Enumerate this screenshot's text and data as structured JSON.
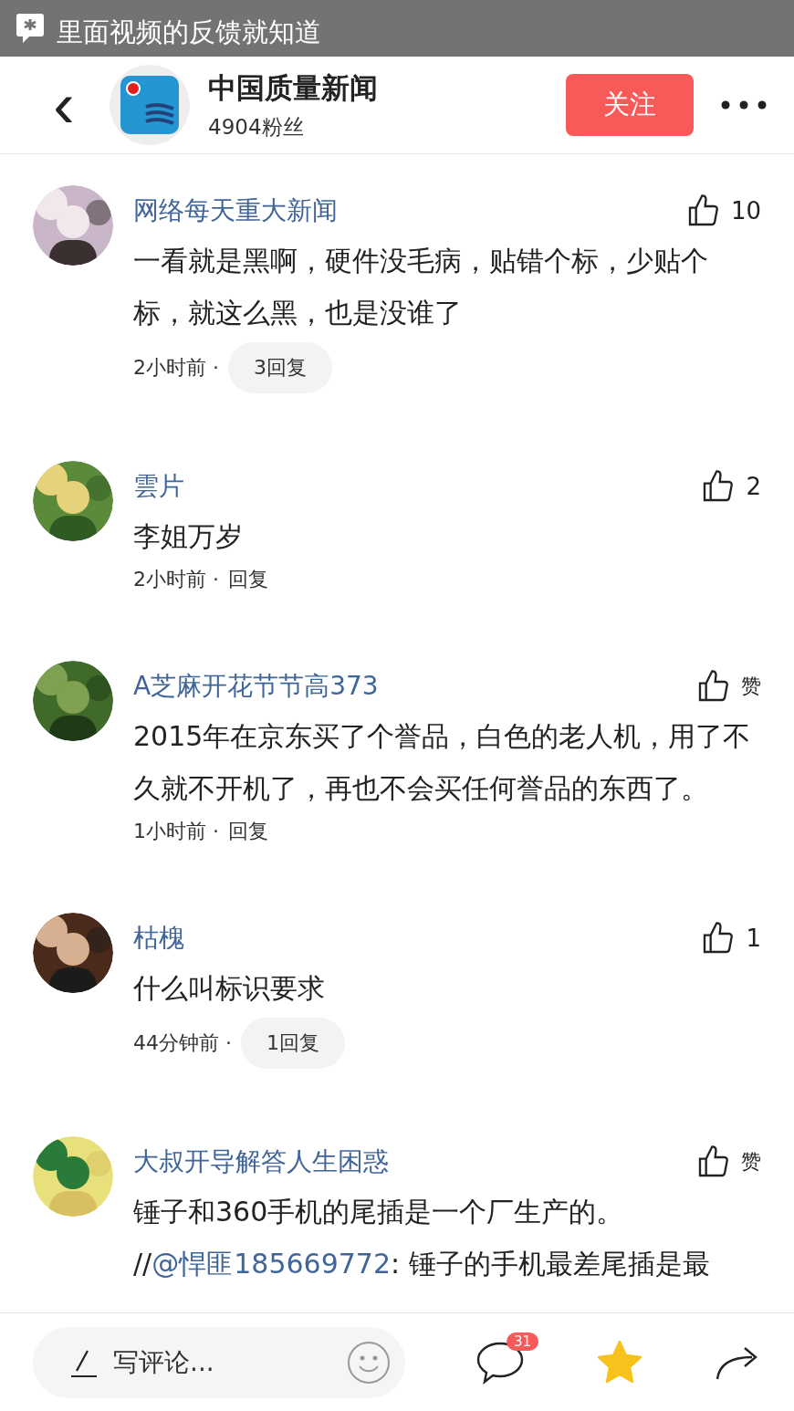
{
  "banner": {
    "text": "里面视频的反馈就知道"
  },
  "header": {
    "back": "‹",
    "account": "中国质量新闻",
    "fans": "4904粉丝",
    "follow": "关注"
  },
  "comments": [
    {
      "name": "网络每天重大新闻",
      "likes": "10",
      "body": [
        {
          "kind": "text",
          "text": "一看就是黑啊，硬件没毛病，贴错个标，少贴个标，就这么黑，也是没谁了"
        }
      ],
      "time": "2小时前 ·",
      "reply": {
        "kind": "pill",
        "label": "3回复"
      }
    },
    {
      "name": "雲片",
      "likes": "2",
      "body": [
        {
          "kind": "text",
          "text": "李姐万岁"
        }
      ],
      "time": "2小时前 ·",
      "reply": {
        "kind": "link",
        "label": "回复"
      }
    },
    {
      "name": "A芝麻开花节节高373",
      "likes": "赞",
      "body": [
        {
          "kind": "text",
          "text": "2015年在京东买了个誉品，白色的老人机，用了不久就不开机了，再也不会买任何誉品的东西了。"
        }
      ],
      "time": "1小时前 ·",
      "reply": {
        "kind": "link",
        "label": "回复"
      }
    },
    {
      "name": "枯槐",
      "likes": "1",
      "body": [
        {
          "kind": "text",
          "text": "什么叫标识要求"
        }
      ],
      "time": "44分钟前 ·",
      "reply": {
        "kind": "pill",
        "label": "1回复"
      }
    },
    {
      "name": "大叔开导解答人生困惑",
      "likes": "赞",
      "body": [
        {
          "kind": "text",
          "text": "锤子和360手机的尾插是一个厂生产的。 //"
        },
        {
          "kind": "mention",
          "text": "@悍匪185669772"
        },
        {
          "kind": "text",
          "text": ": 锤子的手机最差尾插是最"
        }
      ]
    }
  ],
  "bottom_bar": {
    "placeholder": "写评论...",
    "comment_count": "31",
    "favorited": true
  }
}
